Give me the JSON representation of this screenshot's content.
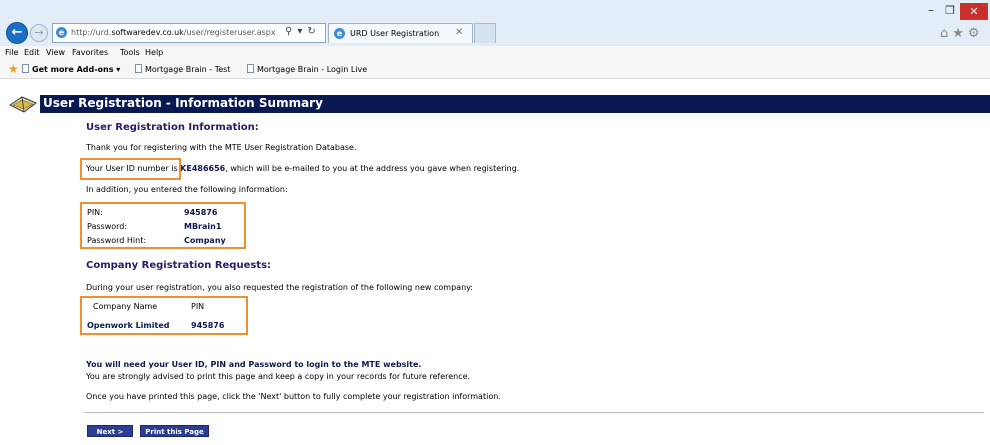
{
  "browser": {
    "url_prefix": "http://urd.",
    "url_domain": "softwaredev.co.uk",
    "url_path": "/user/registeruser.aspx",
    "tab_title": "URD User Registration",
    "menu": [
      "File",
      "Edit",
      "View",
      "Favorites",
      "Tools",
      "Help"
    ],
    "favorites": [
      "Get more Add-ons ▾",
      "Mortgage Brain - Test",
      "Mortgage Brain - Login Live"
    ]
  },
  "page": {
    "title": "User Registration - Information Summary",
    "user_section": {
      "heading": "User Registration Information:",
      "thanks": "Thank you for registering with the MTE User Registration Database.",
      "userid_prefix": "Your User ID number is ",
      "userid_value": "KE486656",
      "userid_suffix": ", which will be e-mailed to you at the address you gave when registering.",
      "addition": "In addition, you entered the following information:",
      "fields": [
        {
          "label": "PIN:",
          "value": "945876"
        },
        {
          "label": "Password:",
          "value": "MBrain1"
        },
        {
          "label": "Password Hint:",
          "value": "Company"
        }
      ]
    },
    "company_section": {
      "heading": "Company Registration Requests:",
      "intro": "During your user registration, you also requested the registration of the following new company:",
      "col_company": "Company Name",
      "col_pin": "PIN",
      "company_name": "Openwork Limited",
      "company_pin": "945876"
    },
    "notice_bold": "You will need your User ID, PIN and Password to login to the MTE website.",
    "advice": "You are strongly advised to print this page and keep a copy in your records for future reference.",
    "instruction": "Once you have printed this page, click the 'Next' button to fully complete your registration information.",
    "buttons": {
      "next": "Next >",
      "print": "Print this Page"
    }
  }
}
